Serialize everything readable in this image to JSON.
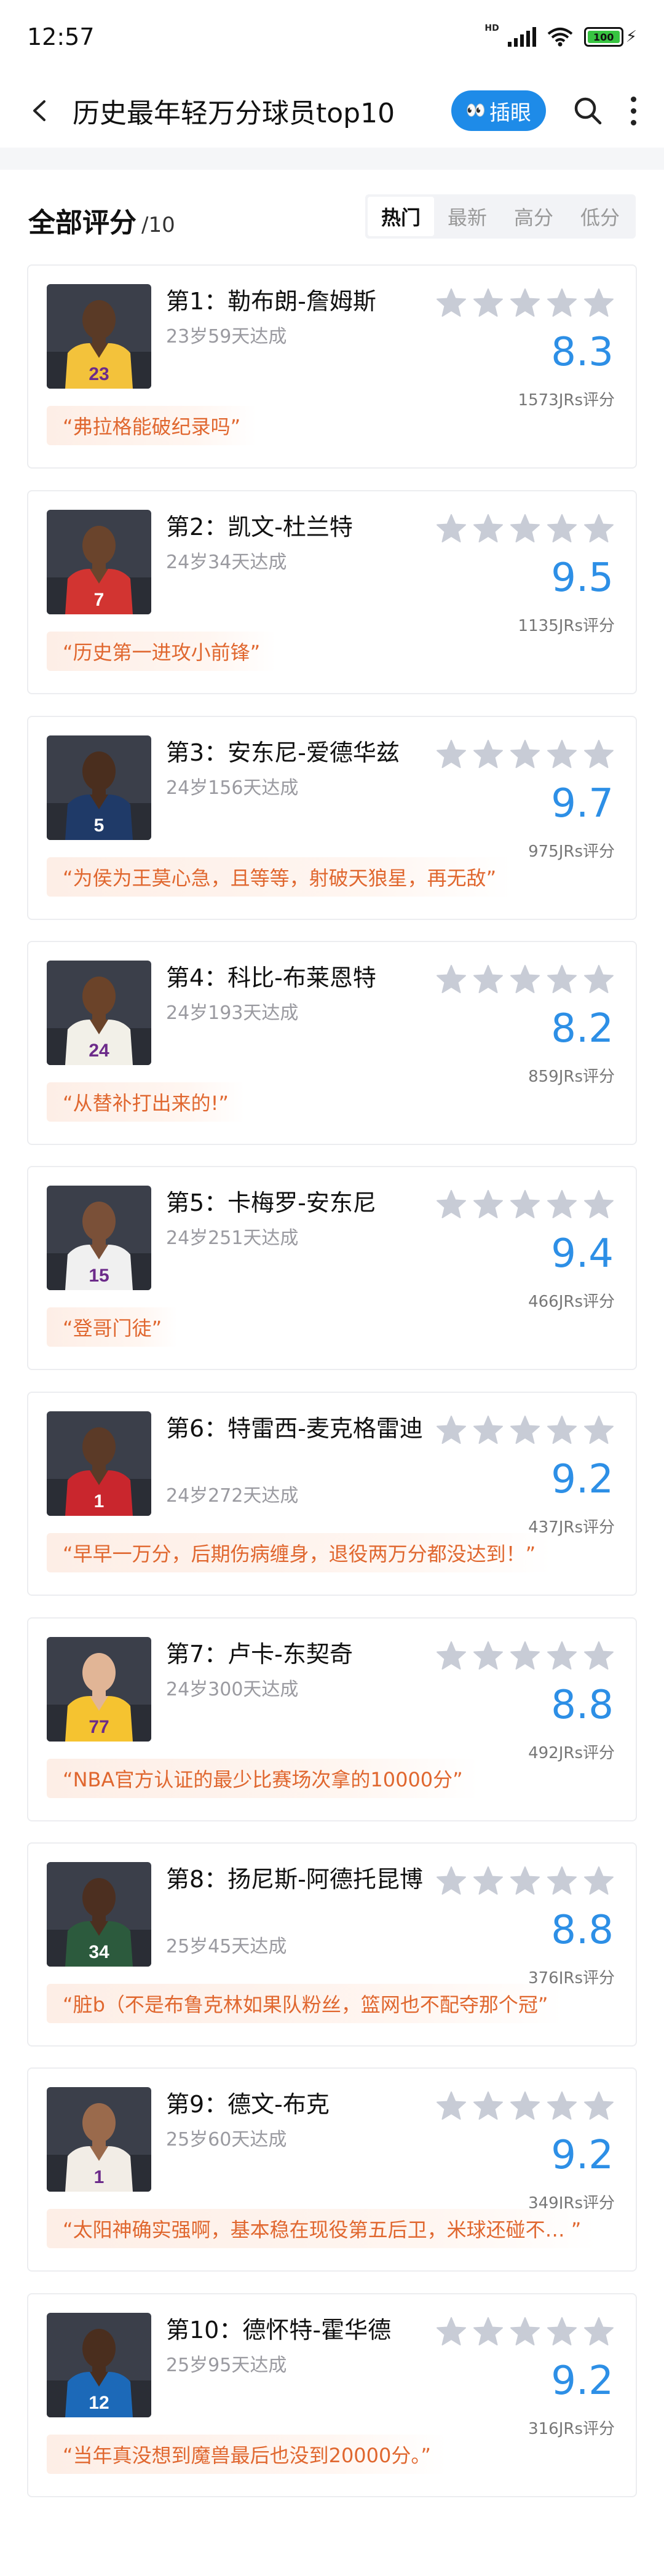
{
  "status_bar": {
    "time": "12:57",
    "hd": "HD",
    "battery": "100"
  },
  "header": {
    "title": "历史最年轻万分球员top10",
    "peek_label": "插眼",
    "peek_icon": "👀"
  },
  "section": {
    "title": "全部评分",
    "subtitle": "/10"
  },
  "tabs": [
    {
      "label": "热门",
      "active": true
    },
    {
      "label": "最新",
      "active": false
    },
    {
      "label": "高分",
      "active": false
    },
    {
      "label": "低分",
      "active": false
    }
  ],
  "players": [
    {
      "name": "第1：勒布朗-詹姆斯",
      "age": "23岁59天达成",
      "score": "8.3",
      "count": "1573JRs评分",
      "quote": "“弗拉格能破纪录吗”",
      "jersey_color": "#f3c23b",
      "number": "23",
      "skin": "#5a3a26"
    },
    {
      "name": "第2：凯文-杜兰特",
      "age": "24岁34天达成",
      "score": "9.5",
      "count": "1135JRs评分",
      "quote": "“历史第一进攻小前锋”",
      "jersey_color": "#d23431",
      "number": "7",
      "skin": "#6a442c"
    },
    {
      "name": "第3：安东尼-爱德华兹",
      "age": "24岁156天达成",
      "score": "9.7",
      "count": "975JRs评分",
      "quote": "“为侯为王莫心急，且等等，射破天狼星，再无敌”",
      "jersey_color": "#1f3a68",
      "number": "5",
      "skin": "#4a2e1e"
    },
    {
      "name": "第4：科比-布莱恩特",
      "age": "24岁193天达成",
      "score": "8.2",
      "count": "859JRs评分",
      "quote": "“从替补打出来的!”",
      "jersey_color": "#f2f0e8",
      "number": "24",
      "skin": "#6b4329"
    },
    {
      "name": "第5：卡梅罗-安东尼",
      "age": "24岁251天达成",
      "score": "9.4",
      "count": "466JRs评分",
      "quote": "“登哥门徒”",
      "jersey_color": "#f0f0f0",
      "number": "15",
      "skin": "#7a5038"
    },
    {
      "name": "第6：特雷西-麦克格雷迪",
      "age": "24岁272天达成",
      "score": "9.2",
      "count": "437JRs评分",
      "quote": "“早早一万分，后期伤病缠身，退役两万分都没达到！”",
      "jersey_color": "#c9262d",
      "number": "1",
      "skin": "#5b3a27"
    },
    {
      "name": "第7：卢卡-东契奇",
      "age": "24岁300天达成",
      "score": "8.8",
      "count": "492JRs评分",
      "quote": "“NBA官方认证的最少比赛场次拿的10000分”",
      "jersey_color": "#f5c330",
      "number": "77",
      "skin": "#e1b596"
    },
    {
      "name": "第8：扬尼斯-阿德托昆博",
      "age": "25岁45天达成",
      "score": "8.8",
      "count": "376JRs评分",
      "quote": "“脏b（不是布鲁克林如果队粉丝，篮网也不配夺那个冠”",
      "jersey_color": "#2c5a3d",
      "number": "34",
      "skin": "#4c2f20"
    },
    {
      "name": "第9：德文-布克",
      "age": "25岁60天达成",
      "score": "9.2",
      "count": "349JRs评分",
      "quote": "“太阳神确实强啊，基本稳在现役第五后卫，米球还碰不…  ”",
      "jersey_color": "#f2ede6",
      "number": "1",
      "skin": "#9a6a4c"
    },
    {
      "name": "第10：德怀特-霍华德",
      "age": "25岁95天达成",
      "score": "9.2",
      "count": "316JRs评分",
      "quote": "“当年真没想到魔兽最后也没到20000分。”",
      "jersey_color": "#1c69b8",
      "number": "12",
      "skin": "#4a2e1e"
    }
  ],
  "colors": {
    "accent": "#2d8fe6",
    "quote_text": "#e0672f",
    "star_empty": "#c8ccd6",
    "peek_bg": "#1e8be8"
  }
}
